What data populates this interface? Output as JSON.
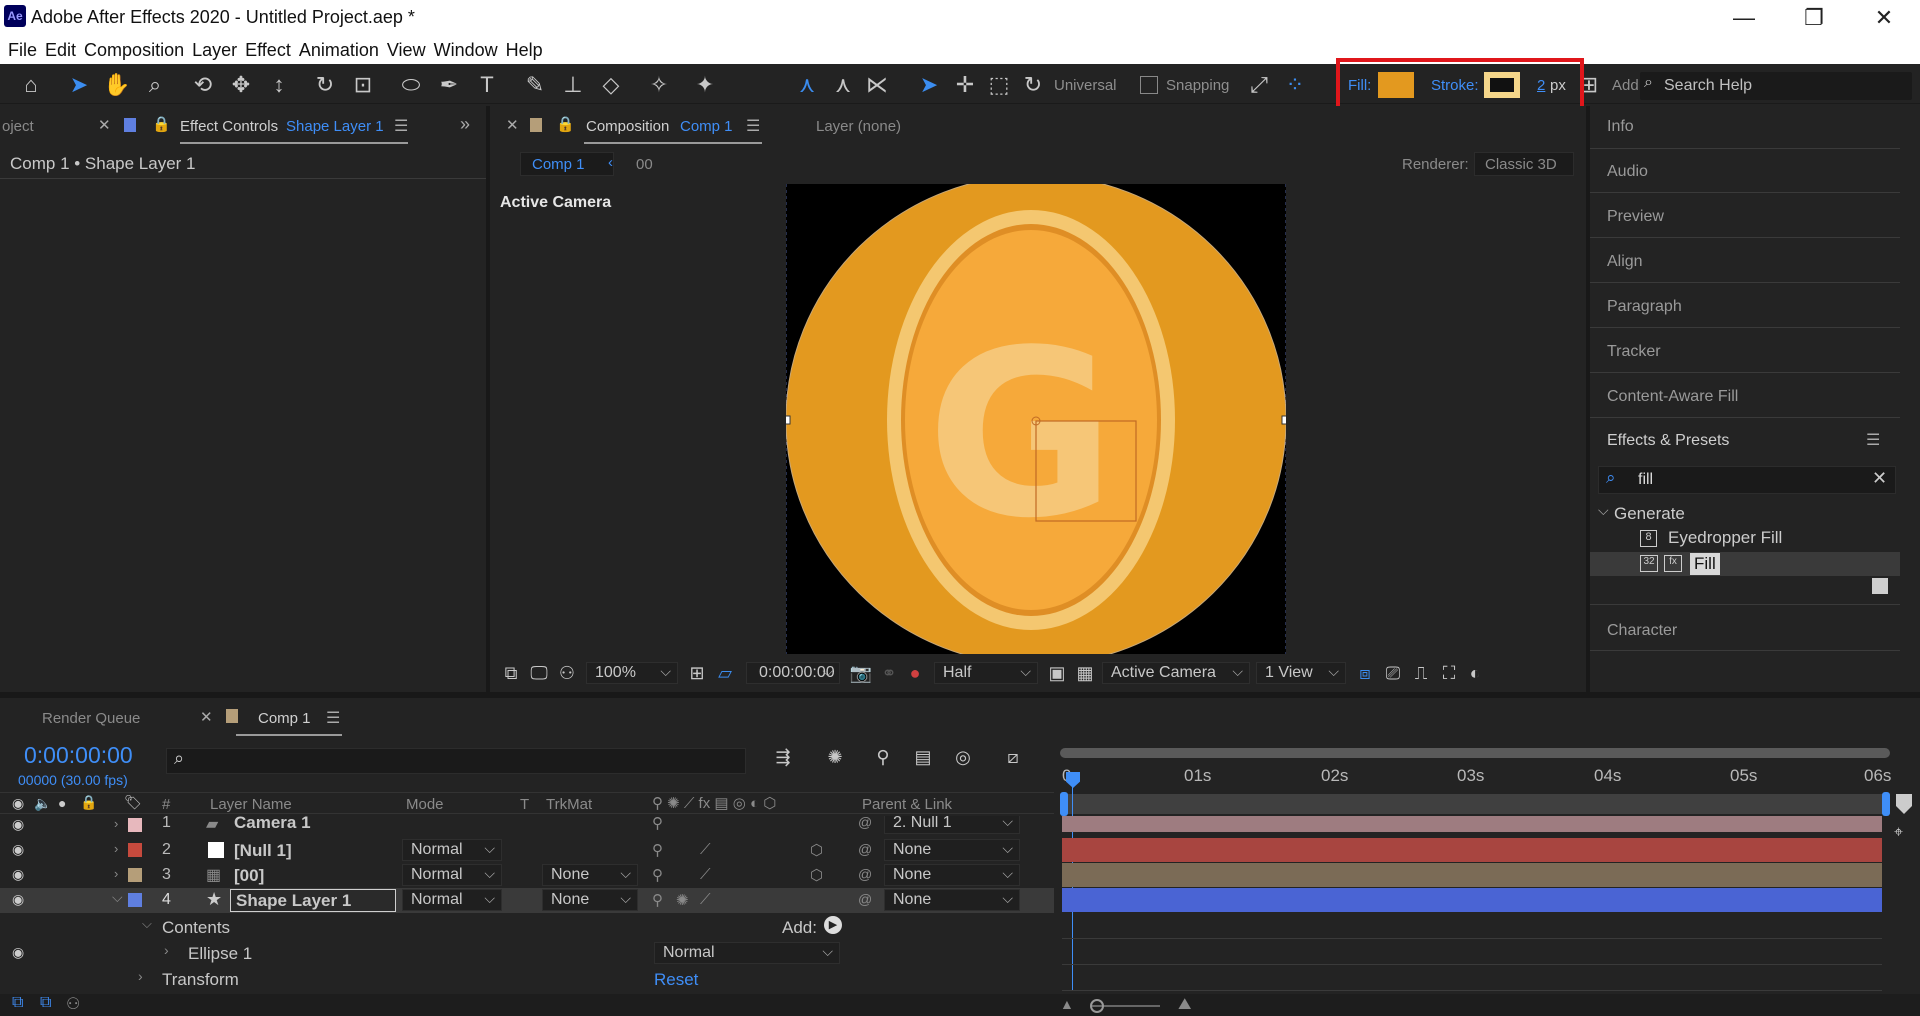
{
  "window": {
    "logo": "Ae",
    "title": "Adobe After Effects 2020 - Untitled Project.aep *",
    "minimize": "—",
    "maximize": "❐",
    "close": "✕"
  },
  "menu": [
    "File",
    "Edit",
    "Composition",
    "Layer",
    "Effect",
    "Animation",
    "View",
    "Window",
    "Help"
  ],
  "toolbar": {
    "universal_label": "Universal",
    "snapping_label": "Snapping",
    "fill_label": "Fill:",
    "fill_color": "#e3991f",
    "stroke_label": "Stroke:",
    "stroke_color": "#f5d68a",
    "stroke_width_value": "2",
    "stroke_width_unit": "px",
    "add_label": "Add:",
    "search_help_placeholder": "Search Help"
  },
  "left_panel": {
    "tab_project": "oject",
    "tab_effect_controls": "Effect Controls",
    "tab_effect_controls_layer": "Shape Layer 1",
    "breadcrumb": "Comp 1 • Shape Layer 1"
  },
  "comp_panel": {
    "tab_label": "Composition",
    "tab_comp_name": "Comp 1",
    "layer_tab": "Layer (none)",
    "nav_comp": "Comp 1",
    "nav_layer": "00",
    "renderer_label": "Renderer:",
    "renderer_value": "Classic 3D",
    "active_camera_label": "Active Camera",
    "zoom": "100%",
    "timecode": "0:00:00:00",
    "resolution": "Half",
    "view_camera": "Active Camera",
    "view_layout": "1 View",
    "coin_color": "#e3991f",
    "coin_letter": "G"
  },
  "right_panel": {
    "items": [
      "Info",
      "Audio",
      "Preview",
      "Align",
      "Paragraph",
      "Tracker",
      "Content-Aware Fill"
    ],
    "effects_presets_label": "Effects & Presets",
    "effects_search_value": "fill",
    "category": "Generate",
    "effects": [
      {
        "name": "Eyedropper Fill",
        "badge": "8"
      },
      {
        "name": "Fill",
        "badge": "32"
      }
    ],
    "character_label": "Character"
  },
  "timeline": {
    "tab_render_queue": "Render Queue",
    "tab_comp": "Comp 1",
    "current_time": "0:00:00:00",
    "frame_info": "00000 (30.00 fps)",
    "columns": {
      "num": "#",
      "layer_name": "Layer Name",
      "mode": "Mode",
      "t": "T",
      "trkmat": "TrkMat",
      "parent": "Parent & Link"
    },
    "layers": [
      {
        "num": "1",
        "name": "Camera 1",
        "label_color": "#e7b8bd",
        "mode": "",
        "trkmat": "",
        "parent": "2. Null 1",
        "bar_color": "#9e7c80"
      },
      {
        "num": "2",
        "name": "[Null 1]",
        "label_color": "#c64a3d",
        "mode": "Normal",
        "trkmat": "",
        "parent": "None",
        "bar_color": "#a84540"
      },
      {
        "num": "3",
        "name": "[00]",
        "label_color": "#b59e79",
        "mode": "Normal",
        "trkmat": "None",
        "parent": "None",
        "bar_color": "#7b6b56"
      },
      {
        "num": "4",
        "name": "Shape Layer 1",
        "label_color": "#5f7fe0",
        "mode": "Normal",
        "trkmat": "None",
        "parent": "None",
        "bar_color": "#4a64d4"
      }
    ],
    "contents_label": "Contents",
    "add_label": "Add:",
    "ellipse_label": "Ellipse 1",
    "ellipse_mode": "Normal",
    "transform_label": "Transform",
    "reset_label": "Reset",
    "ruler_ticks": [
      "0s",
      "01s",
      "02s",
      "03s",
      "04s",
      "05s",
      "06s"
    ]
  }
}
